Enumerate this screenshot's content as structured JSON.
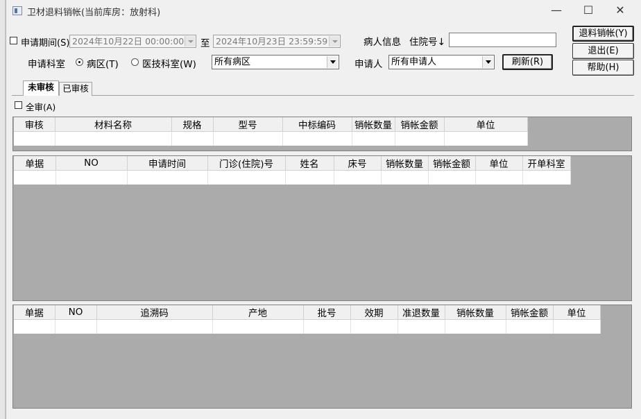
{
  "window": {
    "title": "卫材退料销帐(当前库房：放射科)",
    "minimize": "—",
    "maximize": "☐",
    "close": "✕"
  },
  "filters": {
    "period_label": "申请期间(S)",
    "date_from": "2024年10月22日  00:00:00",
    "to_label": "至",
    "date_to": "2024年10月23日  23:59:59",
    "patient_info_label": "病人信息",
    "inpatient_no_label": "住院号",
    "inpatient_no_value": "",
    "dept_label": "申请科室",
    "ward_radio_label": "病区(T)",
    "medtech_radio_label": "医技科室(W)",
    "ward_selected": "所有病区",
    "applicant_label": "申请人",
    "applicant_selected": "所有申请人",
    "refresh_button": "刷新(R)"
  },
  "actions": {
    "return_button": "退料销帐(Y)",
    "exit_button": "退出(E)",
    "help_button": "帮助(H)"
  },
  "tabs": [
    {
      "label": "未审核",
      "active": true
    },
    {
      "label": "已审核",
      "active": false
    }
  ],
  "select_all_label": "全审(A)",
  "grid1": {
    "columns": [
      "审核",
      "材料名称",
      "规格",
      "型号",
      "中标编码",
      "销帐数量",
      "销帐金额",
      "单位"
    ]
  },
  "grid2": {
    "columns": [
      "单据",
      "NO",
      "申请时间",
      "门诊(住院)号",
      "姓名",
      "床号",
      "销帐数量",
      "销帐金额",
      "单位",
      "开单科室"
    ]
  },
  "grid3": {
    "columns": [
      "单据",
      "NO",
      "追溯码",
      "产地",
      "批号",
      "效期",
      "准退数量",
      "销帐数量",
      "销帐金额",
      "单位"
    ]
  }
}
